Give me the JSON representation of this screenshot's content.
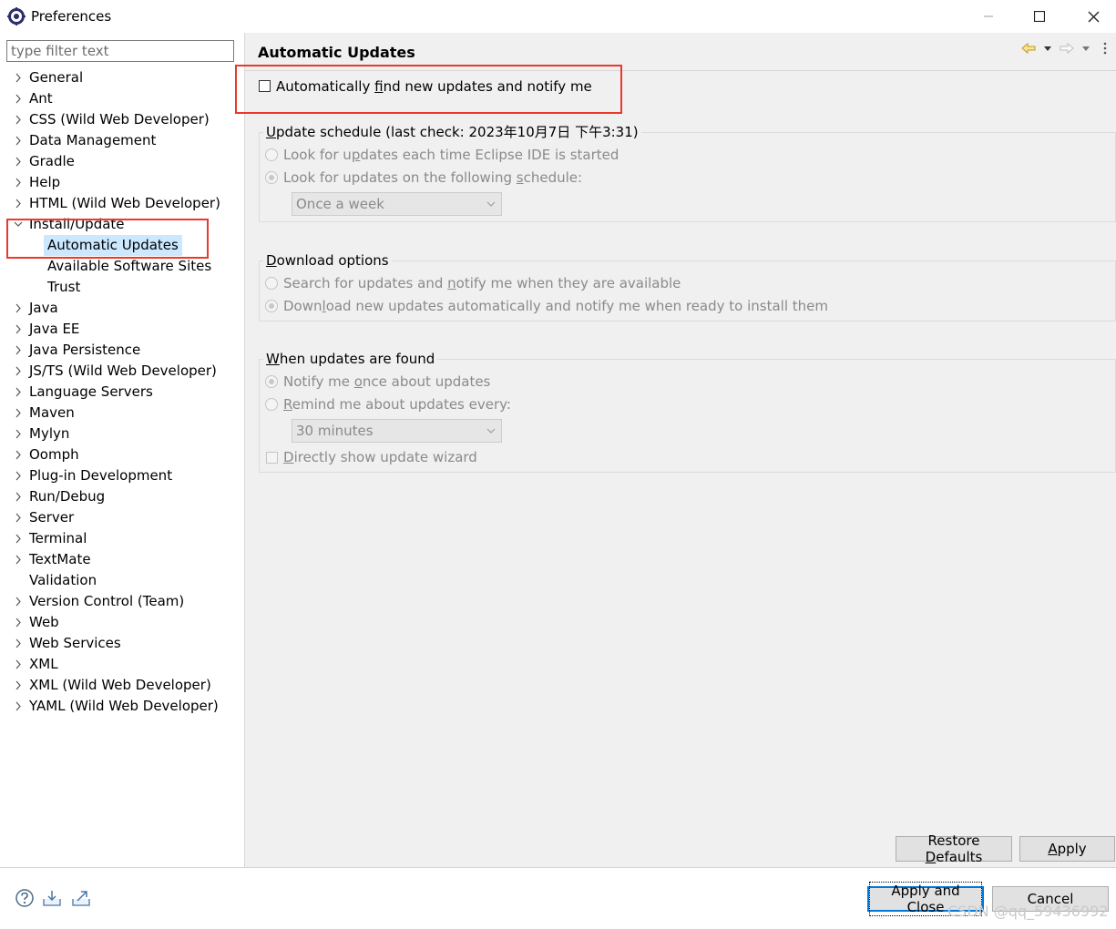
{
  "window": {
    "title": "Preferences"
  },
  "filter": {
    "placeholder": "type filter text"
  },
  "tree": [
    {
      "label": "General",
      "expander": "collapsed",
      "indent": 0
    },
    {
      "label": "Ant",
      "expander": "collapsed",
      "indent": 0
    },
    {
      "label": "CSS (Wild Web Developer)",
      "expander": "collapsed",
      "indent": 0
    },
    {
      "label": "Data Management",
      "expander": "collapsed",
      "indent": 0
    },
    {
      "label": "Gradle",
      "expander": "collapsed",
      "indent": 0
    },
    {
      "label": "Help",
      "expander": "collapsed",
      "indent": 0
    },
    {
      "label": "HTML (Wild Web Developer)",
      "expander": "collapsed",
      "indent": 0
    },
    {
      "label": "Install/Update",
      "expander": "expanded",
      "indent": 0
    },
    {
      "label": "Automatic Updates",
      "expander": "none",
      "indent": 1,
      "selected": true
    },
    {
      "label": "Available Software Sites",
      "expander": "none",
      "indent": 1
    },
    {
      "label": "Trust",
      "expander": "none",
      "indent": 1
    },
    {
      "label": "Java",
      "expander": "collapsed",
      "indent": 0
    },
    {
      "label": "Java EE",
      "expander": "collapsed",
      "indent": 0
    },
    {
      "label": "Java Persistence",
      "expander": "collapsed",
      "indent": 0
    },
    {
      "label": "JS/TS (Wild Web Developer)",
      "expander": "collapsed",
      "indent": 0
    },
    {
      "label": "Language Servers",
      "expander": "collapsed",
      "indent": 0
    },
    {
      "label": "Maven",
      "expander": "collapsed",
      "indent": 0
    },
    {
      "label": "Mylyn",
      "expander": "collapsed",
      "indent": 0
    },
    {
      "label": "Oomph",
      "expander": "collapsed",
      "indent": 0
    },
    {
      "label": "Plug-in Development",
      "expander": "collapsed",
      "indent": 0
    },
    {
      "label": "Run/Debug",
      "expander": "collapsed",
      "indent": 0
    },
    {
      "label": "Server",
      "expander": "collapsed",
      "indent": 0
    },
    {
      "label": "Terminal",
      "expander": "collapsed",
      "indent": 0
    },
    {
      "label": "TextMate",
      "expander": "collapsed",
      "indent": 0
    },
    {
      "label": "Validation",
      "expander": "none",
      "indent": 0
    },
    {
      "label": "Version Control (Team)",
      "expander": "collapsed",
      "indent": 0
    },
    {
      "label": "Web",
      "expander": "collapsed",
      "indent": 0
    },
    {
      "label": "Web Services",
      "expander": "collapsed",
      "indent": 0
    },
    {
      "label": "XML",
      "expander": "collapsed",
      "indent": 0
    },
    {
      "label": "XML (Wild Web Developer)",
      "expander": "collapsed",
      "indent": 0
    },
    {
      "label": "YAML (Wild Web Developer)",
      "expander": "collapsed",
      "indent": 0
    }
  ],
  "page": {
    "title": "Automatic Updates",
    "auto_find": {
      "pre": "Automatically ",
      "mn": "f",
      "post": "ind new updates and notify me",
      "checked": false
    },
    "schedule": {
      "legend": {
        "pre": "",
        "mn": "U",
        "post": "pdate schedule (last check: 2023年10月7日 下午3:31)"
      },
      "opt_startup": {
        "pre": "Look for u",
        "mn": "p",
        "post": "dates each time Eclipse IDE is started",
        "checked": false
      },
      "opt_schedule": {
        "pre": "Look for updates on the following ",
        "mn": "s",
        "post": "chedule:",
        "checked": true
      },
      "frequency": "Once a week"
    },
    "download": {
      "legend": {
        "pre": "",
        "mn": "D",
        "post": "ownload options"
      },
      "opt_notify": {
        "pre": "Search for updates and ",
        "mn": "n",
        "post": "otify me when they are available",
        "checked": false
      },
      "opt_auto": {
        "pre": "Down",
        "mn": "l",
        "post": "oad new updates automatically and notify me when ready to install them",
        "checked": true
      }
    },
    "found": {
      "legend": {
        "pre": "",
        "mn": "W",
        "post": "hen updates are found"
      },
      "opt_once": {
        "pre": "Notify me ",
        "mn": "o",
        "post": "nce about updates",
        "checked": true
      },
      "opt_remind": {
        "pre": "",
        "mn": "R",
        "post": "emind me about updates every:",
        "checked": false
      },
      "interval": "30 minutes",
      "show_wizard": {
        "pre": "",
        "mn": "D",
        "post": "irectly show update wizard",
        "checked": false
      }
    }
  },
  "buttons": {
    "restore": {
      "pre": "Restore ",
      "mn": "D",
      "post": "efaults"
    },
    "apply": {
      "pre": "",
      "mn": "A",
      "post": "pply"
    },
    "apply_close": "Apply and Close",
    "cancel": "Cancel"
  },
  "watermark": "CSDN @qq_59436992",
  "colors": {
    "highlight": "#e8392a",
    "selection": "#cce8ff",
    "panel": "#f0f0f0",
    "default_button_border": "#0078d7"
  },
  "icons": [
    "eclipse-preferences-icon",
    "minimize-icon",
    "maximize-icon",
    "close-icon",
    "back-icon",
    "forward-icon",
    "help-icon",
    "import-icon",
    "export-icon"
  ]
}
